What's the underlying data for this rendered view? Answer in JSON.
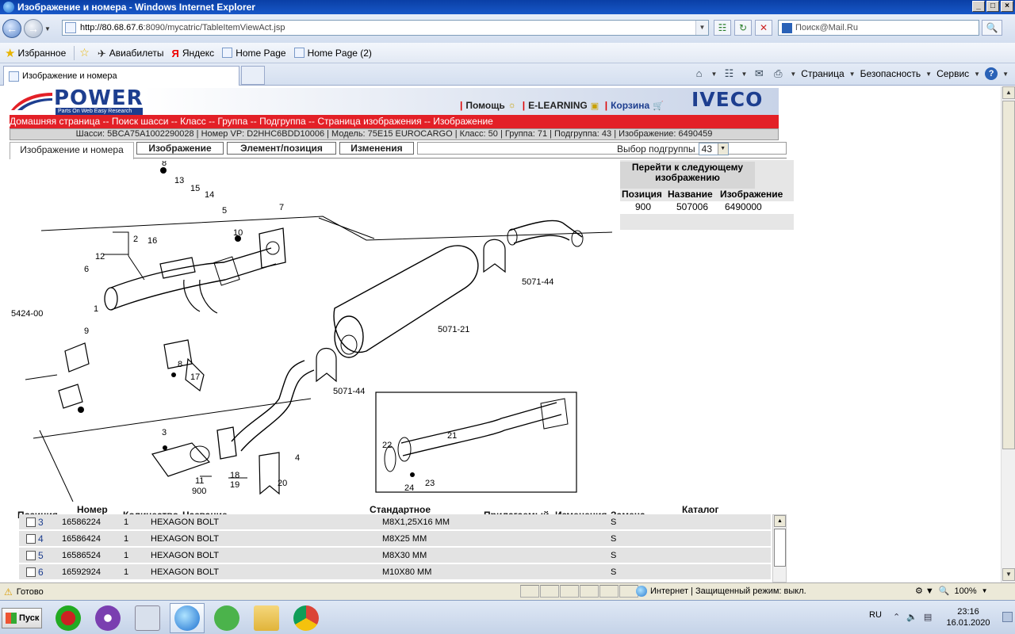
{
  "window": {
    "title": "Изображение и номера - Windows Internet Explorer"
  },
  "address": {
    "url_host": "http://80.68.67.6",
    "url_rest": ":8090/mycatric/TableItemViewAct.jsp",
    "search_placeholder": "Поиск@Mail.Ru"
  },
  "favorites": {
    "label": "Избранное",
    "links": [
      "Авиабилеты",
      "Яндекс",
      "Home Page",
      "Home Page (2)"
    ]
  },
  "tab": {
    "label": "Изображение и номера"
  },
  "commandbar": {
    "page": "Страница",
    "safety": "Безопасность",
    "service": "Сервис"
  },
  "header": {
    "brand": "POWER",
    "brand_tagline": "Parts On Web Easy Research",
    "help": "Помощь",
    "elearning": "E-LEARNING",
    "cart": "Корзина",
    "make": "IVECO"
  },
  "breadcrumb": "Домашняя страница -- Поиск шасси -- Класс -- Группа -- Подгруппа -- Страница изображения -- Изображение",
  "infobar": "Шасси: 5BCA75A1002290028 | Номер VP: D2HHC6BDD10006 | Модель: 75E15 EUROCARGO | Класс: 50 | Группа: 71 | Подгруппа: 43 | Изображение: 6490459",
  "inner_tabs": {
    "active": "Изображение и номера",
    "image": "Изображение",
    "element": "Элемент/позиция",
    "changes": "Изменения"
  },
  "subgroup": {
    "label": "Выбор подгруппы",
    "value": "43"
  },
  "next_image": {
    "title": "Перейти к следующему изображению",
    "headers": [
      "Позиция",
      "Название",
      "Изображение"
    ],
    "row": [
      "900",
      "507006",
      "6490000"
    ]
  },
  "diagram_labels": {
    "l8a": "8",
    "l13": "13",
    "l15": "15",
    "l14": "14",
    "l5": "5",
    "l7": "7",
    "l10": "10",
    "l12": "12",
    "l2": "2",
    "l16": "16",
    "l6": "6",
    "l1": "1",
    "l9": "9",
    "l5424": "5424-00",
    "l5071_44a": "5071-44",
    "l5071_21": "5071-21",
    "l5071_44b": "5071-44",
    "l8b": "8",
    "l17": "17",
    "l3": "3",
    "l11": "11",
    "l900": "900",
    "l18": "18",
    "l19": "19",
    "l20": "20",
    "l4": "4",
    "l21": "21",
    "l22": "22",
    "l24": "24",
    "l23": "23"
  },
  "table": {
    "headers": [
      "Позиция",
      "Номер",
      "Количество",
      "Название",
      "Стандартное",
      "Прилагаемый",
      "Изменения",
      "Замена",
      "--",
      "Каталог"
    ],
    "rows": [
      {
        "pos": "3",
        "num": "16586224",
        "qty": "1",
        "name": "HEXAGON BOLT",
        "std": "M8X1,25X16 MM",
        "rep": "S"
      },
      {
        "pos": "4",
        "num": "16586424",
        "qty": "1",
        "name": "HEXAGON BOLT",
        "std": "M8X25 MM",
        "rep": "S"
      },
      {
        "pos": "5",
        "num": "16586524",
        "qty": "1",
        "name": "HEXAGON BOLT",
        "std": "M8X30 MM",
        "rep": "S"
      },
      {
        "pos": "6",
        "num": "16592924",
        "qty": "1",
        "name": "HEXAGON BOLT",
        "std": "M10X80 MM",
        "rep": "S"
      }
    ]
  },
  "status": {
    "ready": "Готово",
    "zone": "Интернет | Защищенный режим: выкл.",
    "zoom": "100%"
  },
  "taskbar": {
    "start": "Пуск",
    "lang": "RU",
    "time": "23:16",
    "date": "16.01.2020"
  }
}
